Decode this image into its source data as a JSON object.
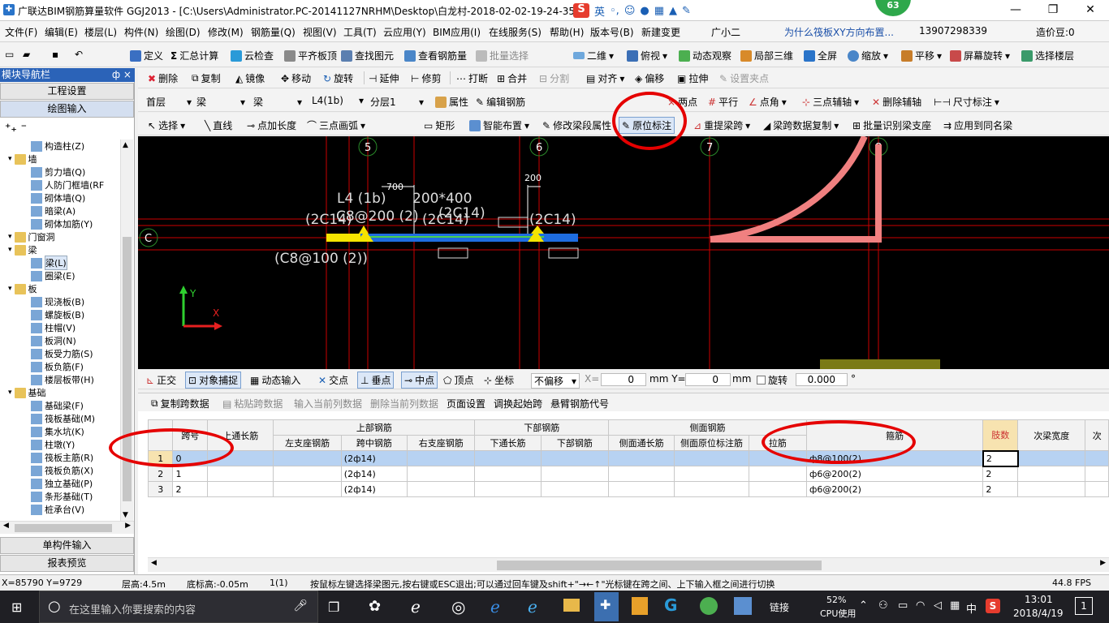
{
  "title_bar": {
    "title": "广联达BIM钢筋算量软件 GGJ2013 - [C:\\Users\\Administrator.PC-20141127NRHM\\Desktop\\白龙村-2018-02-02-19-24-35",
    "ime_lang": "英",
    "badge": "63"
  },
  "menu": [
    "文件(F)",
    "编辑(E)",
    "楼层(L)",
    "构件(N)",
    "绘图(D)",
    "修改(M)",
    "钢筋量(Q)",
    "视图(V)",
    "工具(T)",
    "云应用(Y)",
    "BIM应用(I)",
    "在线服务(S)",
    "帮助(H)",
    "版本号(B)",
    "新建变更",
    "广小二",
    "为什么筏板XY方向布置...",
    "13907298339",
    "造价豆:0"
  ],
  "toolbar1": [
    "定义",
    "汇总计算",
    "云检查",
    "平齐板顶",
    "查找图元",
    "查看钢筋量",
    "批量选择",
    "二维",
    "俯视",
    "动态观察",
    "局部三维",
    "全屏",
    "缩放",
    "平移",
    "屏幕旋转",
    "选择楼层"
  ],
  "panel": {
    "title": "模块导航栏",
    "pin": "ф ×",
    "btn_engineering": "工程设置",
    "btn_drawing": "绘图输入",
    "btn_single": "单构件输入",
    "btn_report": "报表预览"
  },
  "tree": [
    {
      "label": "构造柱(Z)",
      "type": "leaf",
      "indent": 2
    },
    {
      "label": "墙",
      "type": "folder",
      "indent": 1
    },
    {
      "label": "剪力墙(Q)",
      "type": "leaf",
      "indent": 2
    },
    {
      "label": "人防门框墙(RF",
      "type": "leaf",
      "indent": 2
    },
    {
      "label": "砌体墙(Q)",
      "type": "leaf",
      "indent": 2
    },
    {
      "label": "暗梁(A)",
      "type": "leaf",
      "indent": 2
    },
    {
      "label": "砌体加筋(Y)",
      "type": "leaf",
      "indent": 2
    },
    {
      "label": "门窗洞",
      "type": "folder",
      "indent": 1
    },
    {
      "label": "梁",
      "type": "folder",
      "indent": 1
    },
    {
      "label": "梁(L)",
      "type": "leaf",
      "indent": 2
    },
    {
      "label": "圈梁(E)",
      "type": "leaf",
      "indent": 2
    },
    {
      "label": "板",
      "type": "folder",
      "indent": 1
    },
    {
      "label": "现浇板(B)",
      "type": "leaf",
      "indent": 2
    },
    {
      "label": "螺旋板(B)",
      "type": "leaf",
      "indent": 2
    },
    {
      "label": "柱帽(V)",
      "type": "leaf",
      "indent": 2
    },
    {
      "label": "板洞(N)",
      "type": "leaf",
      "indent": 2
    },
    {
      "label": "板受力筋(S)",
      "type": "leaf",
      "indent": 2
    },
    {
      "label": "板负筋(F)",
      "type": "leaf",
      "indent": 2
    },
    {
      "label": "楼层板带(H)",
      "type": "leaf",
      "indent": 2
    },
    {
      "label": "基础",
      "type": "folder",
      "indent": 1
    },
    {
      "label": "基础梁(F)",
      "type": "leaf",
      "indent": 2
    },
    {
      "label": "筏板基础(M)",
      "type": "leaf",
      "indent": 2
    },
    {
      "label": "集水坑(K)",
      "type": "leaf",
      "indent": 2
    },
    {
      "label": "柱墩(Y)",
      "type": "leaf",
      "indent": 2
    },
    {
      "label": "筏板主筋(R)",
      "type": "leaf",
      "indent": 2
    },
    {
      "label": "筏板负筋(X)",
      "type": "leaf",
      "indent": 2
    },
    {
      "label": "独立基础(P)",
      "type": "leaf",
      "indent": 2
    },
    {
      "label": "条形基础(T)",
      "type": "leaf",
      "indent": 2
    },
    {
      "label": "桩承台(V)",
      "type": "leaf",
      "indent": 2
    }
  ],
  "toolbar2": [
    "删除",
    "复制",
    "镜像",
    "移动",
    "旋转",
    "延伸",
    "修剪",
    "打断",
    "合并",
    "分割",
    "对齐",
    "偏移",
    "拉伸",
    "设置夹点"
  ],
  "toolbar3": {
    "floor": "首层",
    "type1": "梁",
    "type2": "梁",
    "name": "L4(1b)",
    "layer": "分层1",
    "items": [
      "属性",
      "编辑钢筋",
      "两点",
      "平行",
      "点角",
      "三点辅轴",
      "删除辅轴",
      "尺寸标注"
    ]
  },
  "toolbar4": [
    "选择",
    "直线",
    "点加长度",
    "三点画弧",
    "矩形",
    "智能布置",
    "修改梁段属性",
    "原位标注",
    "重提梁跨",
    "梁跨数据复制",
    "批量识别梁支座",
    "应用到同名梁"
  ],
  "canvas": {
    "axes": [
      "5",
      "6",
      "7",
      "8",
      "C"
    ],
    "annotations": {
      "beam_name": "L4 (1b)",
      "beam_size": "200*400",
      "stirrup_top": "C8@200 (2)",
      "dim1": "700",
      "dim2": "200",
      "left_bar": "(2C14)",
      "mid_bar": "(2C14)",
      "mid_bar2": "(2C14)",
      "right_bar": "(2C14)",
      "bottom_stirrup": "(C8@100 (2))"
    },
    "ucs_y": "Y",
    "ucs_x": "X"
  },
  "snapbar": {
    "items": [
      "正交",
      "对象捕捉",
      "动态输入",
      "交点",
      "垂点",
      "中点",
      "顶点",
      "坐标"
    ],
    "offset": "不偏移",
    "x_label": "X=",
    "x_value": "0",
    "y_label": "mm Y=",
    "y_value": "0",
    "mm": "mm",
    "rotate_label": "旋转",
    "rotate_value": "0.000",
    "deg": "°"
  },
  "gridtoolbar": [
    "复制跨数据",
    "粘贴跨数据",
    "输入当前列数据",
    "删除当前列数据",
    "页面设置",
    "调换起始跨",
    "悬臂钢筋代号"
  ],
  "grid": {
    "header_top": [
      "跨号",
      "上通长筋",
      "上部钢筋",
      "下部钢筋",
      "侧面钢筋",
      "箍筋",
      "肢数",
      "次梁宽度",
      "次"
    ],
    "header_sub": [
      "左支座钢筋",
      "跨中钢筋",
      "右支座钢筋",
      "下通长筋",
      "下部钢筋",
      "侧面通长筋",
      "侧面原位标注筋",
      "拉筋"
    ],
    "rows": [
      {
        "no": "1",
        "span": "0",
        "mid": "(2ф14)",
        "stirrup": "ф8@100(2)",
        "legs": "2"
      },
      {
        "no": "2",
        "span": "1",
        "mid": "(2ф14)",
        "stirrup": "ф6@200(2)",
        "legs": "2"
      },
      {
        "no": "3",
        "span": "2",
        "mid": "(2ф14)",
        "stirrup": "ф6@200(2)",
        "legs": "2"
      }
    ]
  },
  "status": {
    "coords": "X=85790 Y=9729",
    "floor_height": "层高:4.5m",
    "base_height": "底标高:-0.05m",
    "count": "1(1)",
    "hint": "按鼠标左键选择梁图元,按右键或ESC退出;可以通过回车键及shift+\"→←↑\"光标键在跨之间、上下输入框之间进行切换",
    "fps": "44.8 FPS"
  },
  "taskbar": {
    "search_placeholder": "在这里输入你要搜索的内容",
    "link": "链接",
    "cpu_percent": "52%",
    "cpu_label": "CPU使用",
    "lang": "中",
    "time": "13:01",
    "date": "2018/4/19",
    "notify": "1"
  },
  "colors": {
    "highlight": "#e50000",
    "title_blue": "#2b63b8",
    "canvas": "#000000",
    "selected_row": "#b7d2f2"
  }
}
